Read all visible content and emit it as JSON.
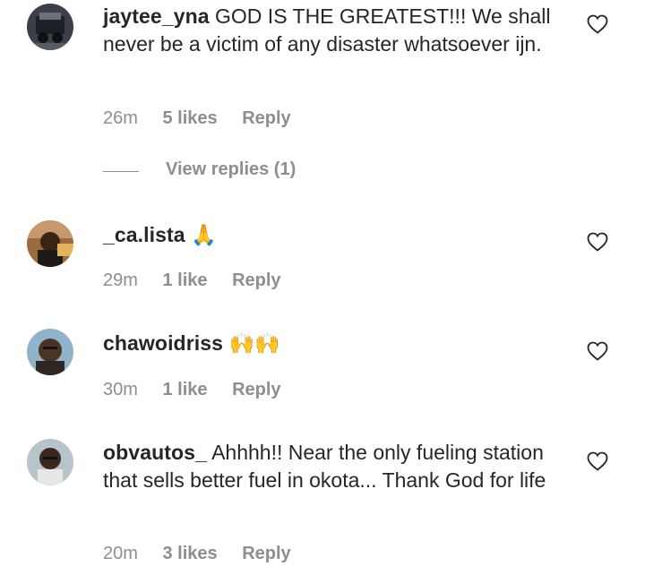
{
  "comments": [
    {
      "username": "jaytee_yna",
      "text": "GOD IS THE GREATEST!!! We shall never be a victim of any disaster whatsoever ijn.",
      "time": "26m",
      "likes": "5 likes",
      "reply": "Reply",
      "view_replies": "View replies (1)"
    },
    {
      "username": "_ca.lista",
      "text": "🙏",
      "time": "29m",
      "likes": "1 like",
      "reply": "Reply"
    },
    {
      "username": "chawoidriss",
      "text": "🙌🙌",
      "time": "30m",
      "likes": "1 like",
      "reply": "Reply"
    },
    {
      "username": "obvautos_",
      "text": "Ahhhh!! Near the only fueling station that sells better fuel in okota... Thank God for life",
      "time": "20m",
      "likes": "3 likes",
      "reply": "Reply"
    }
  ],
  "colors": {
    "text": "#262626",
    "meta": "#8e8e8e",
    "emoji": "#f5b82e"
  },
  "icons": {
    "like": "heart-outline-icon"
  }
}
